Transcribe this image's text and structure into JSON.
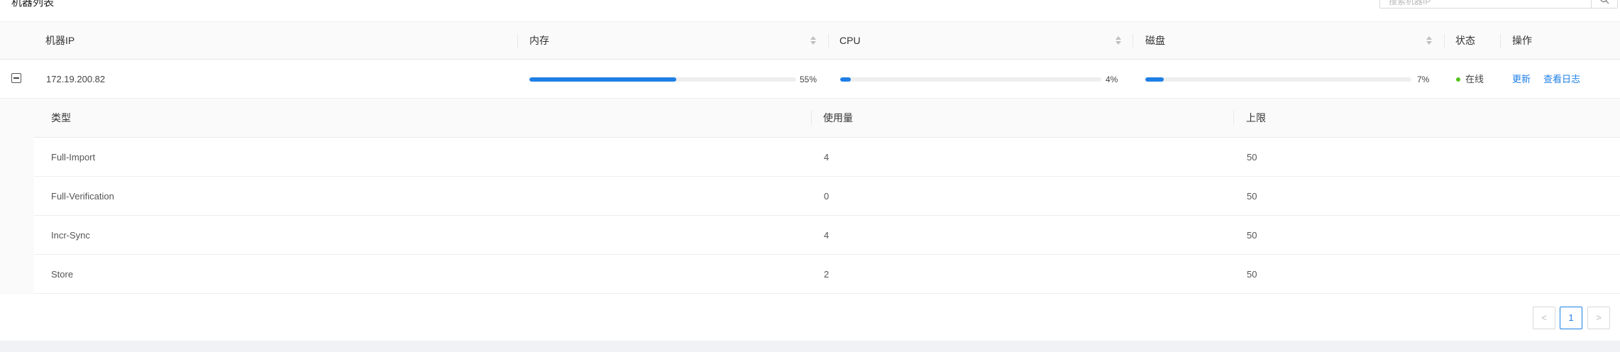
{
  "header": {
    "title": "机器列表",
    "search_placeholder": "搜索机器IP"
  },
  "table": {
    "columns": {
      "ip": "机器IP",
      "memory": "内存",
      "cpu": "CPU",
      "disk": "磁盘",
      "status": "状态",
      "actions": "操作"
    },
    "row": {
      "ip": "172.19.200.82",
      "memory": {
        "label": "55%",
        "fraction": 0.55
      },
      "cpu": {
        "label": "4%",
        "fraction": 0.04
      },
      "disk": {
        "label": "7%",
        "fraction": 0.07
      },
      "status": "在线",
      "status_color": "#52c41a",
      "action_update": "更新",
      "action_logs": "查看日志"
    }
  },
  "nested": {
    "columns": {
      "type": "类型",
      "used": "使用量",
      "limit": "上限"
    },
    "rows": [
      {
        "type": "Full-Import",
        "used": "4",
        "limit": "50"
      },
      {
        "type": "Full-Verification",
        "used": "0",
        "limit": "50"
      },
      {
        "type": "Incr-Sync",
        "used": "4",
        "limit": "50"
      },
      {
        "type": "Store",
        "used": "2",
        "limit": "50"
      }
    ]
  },
  "pagination": {
    "prev": "<",
    "current": "1",
    "next": ">"
  },
  "colors": {
    "accent": "#1f7fe5",
    "online": "#52c41a"
  }
}
